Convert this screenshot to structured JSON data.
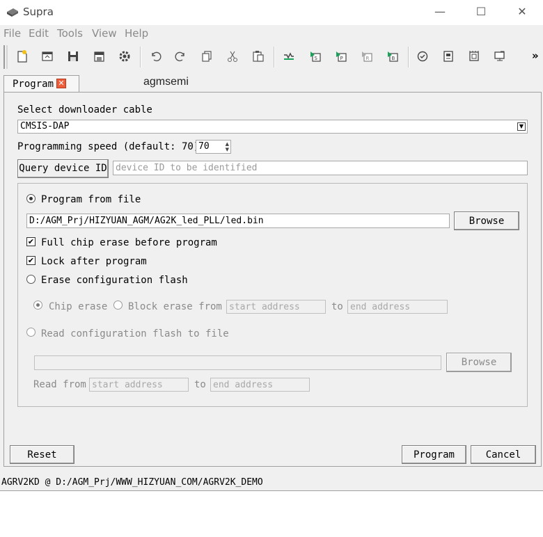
{
  "window": {
    "title": "Supra",
    "minimize": "—",
    "maximize": "☐",
    "close": "✕"
  },
  "menu": [
    "File",
    "Edit",
    "Tools",
    "View",
    "Help"
  ],
  "toolbar": {
    "more": "»",
    "icons": [
      "new-file-icon",
      "open-icon",
      "save-icon",
      "save-all-icon",
      "settings-icon",
      "undo-icon",
      "redo-icon",
      "copy-icon",
      "cut-icon",
      "paste-icon",
      "compile-icon",
      "synthesize-icon",
      "place-icon",
      "route-icon",
      "bitstream-icon",
      "check-icon",
      "program-chip-icon",
      "device-icon",
      "monitor-icon"
    ]
  },
  "tabs": {
    "program": "Program",
    "program_close": "✕",
    "other": "agmsemi"
  },
  "form": {
    "cable_label": "Select downloader cable",
    "cable_value": "CMSIS-DAP",
    "speed_label": "Programming speed (default: 70)",
    "speed_value": "70",
    "query_button": "Query device ID",
    "device_id_placeholder": "device ID to be identified",
    "program_from_file": "Program from file",
    "file_path": "D:/AGM_Prj/HIZYUAN_AGM/AG2K_led_PLL/led.bin",
    "browse": "Browse",
    "full_erase": "Full chip erase before program",
    "lock_after": "Lock after program",
    "erase_config": "Erase configuration flash",
    "chip_erase": "Chip erase",
    "block_erase_from": "Block erase from",
    "start_address_placeholder": "start address",
    "to": "to",
    "end_address_placeholder": "end address",
    "read_config": "Read configuration flash to file",
    "read_path": "",
    "browse2": "Browse",
    "read_from": "Read from",
    "read_start_placeholder": "start address",
    "read_to": "to",
    "read_end_placeholder": "end address"
  },
  "buttons": {
    "reset": "Reset",
    "program": "Program",
    "cancel": "Cancel"
  },
  "status": "AGRV2KD @ D:/AGM_Prj/WWW_HIZYUAN_COM/AGRV2K_DEMO"
}
